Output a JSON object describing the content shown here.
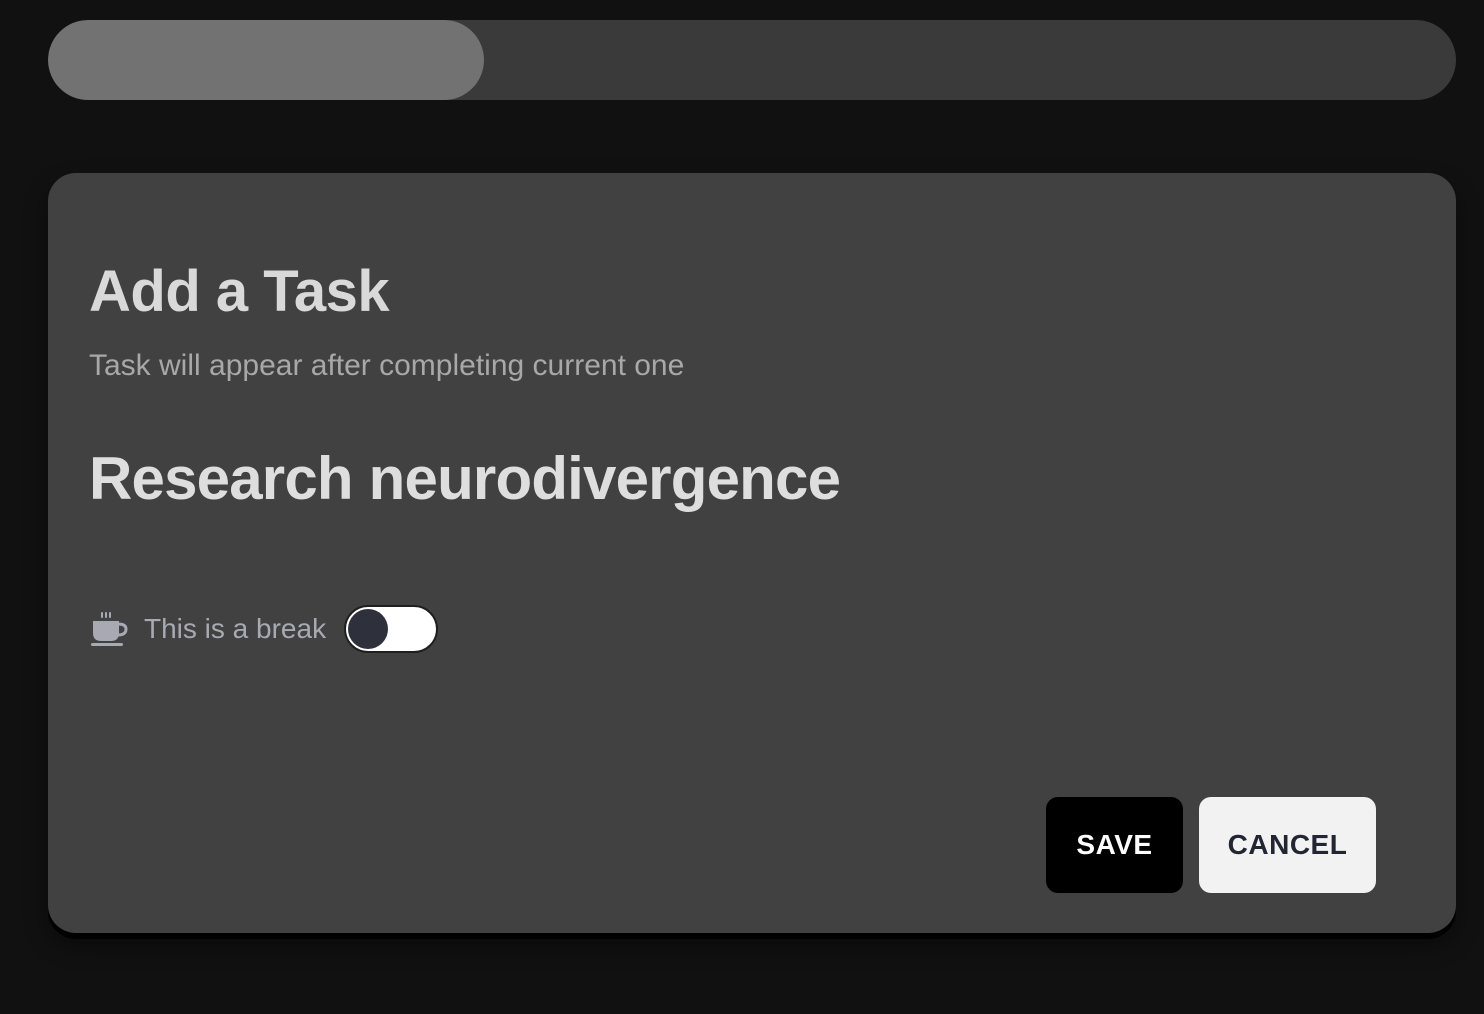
{
  "progress": {
    "fraction": 0.31,
    "track_color": "#3a3a3a",
    "fill_color": "#727272"
  },
  "dialog": {
    "title": "Add a Task",
    "subtitle": "Task will appear after completing current one",
    "task_name": "Research neurodivergence",
    "break_toggle": {
      "icon": "coffee-cup-icon",
      "label": "This is a break",
      "checked": false
    },
    "buttons": {
      "save_label": "SAVE",
      "cancel_label": "CANCEL"
    }
  }
}
